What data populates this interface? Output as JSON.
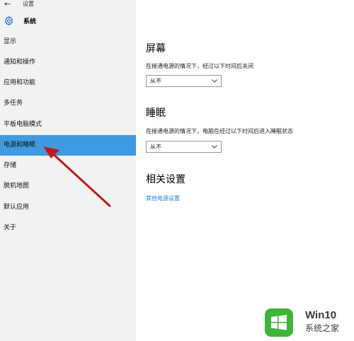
{
  "window": {
    "back_glyph": "←",
    "title": "设置"
  },
  "sidebar": {
    "section_icon": "gear-icon",
    "section_title": "系统",
    "items": [
      {
        "label": "显示"
      },
      {
        "label": "通知和操作"
      },
      {
        "label": "应用和功能"
      },
      {
        "label": "多任务"
      },
      {
        "label": "平板电脑模式"
      },
      {
        "label": "电源和睡眠",
        "selected": true
      },
      {
        "label": "存储"
      },
      {
        "label": "脱机地图"
      },
      {
        "label": "默认应用"
      },
      {
        "label": "关于"
      }
    ]
  },
  "main": {
    "screen": {
      "heading": "屏幕",
      "description": "在接通电源的情况下，经过以下时间后关闭",
      "value": "从不"
    },
    "sleep": {
      "heading": "睡眠",
      "description": "在接通电源的情况下，电脑在经过以下时间后进入睡眠状态",
      "value": "从不"
    },
    "related": {
      "heading": "相关设置",
      "link": "其他电源设置"
    }
  },
  "watermark": {
    "title": "Win10",
    "subtitle": "系统之家"
  },
  "colors": {
    "accent": "#3f9ae0",
    "link": "#1f7fd6",
    "arrow": "#c01818",
    "sidebar_bg": "#f2f2f2"
  }
}
